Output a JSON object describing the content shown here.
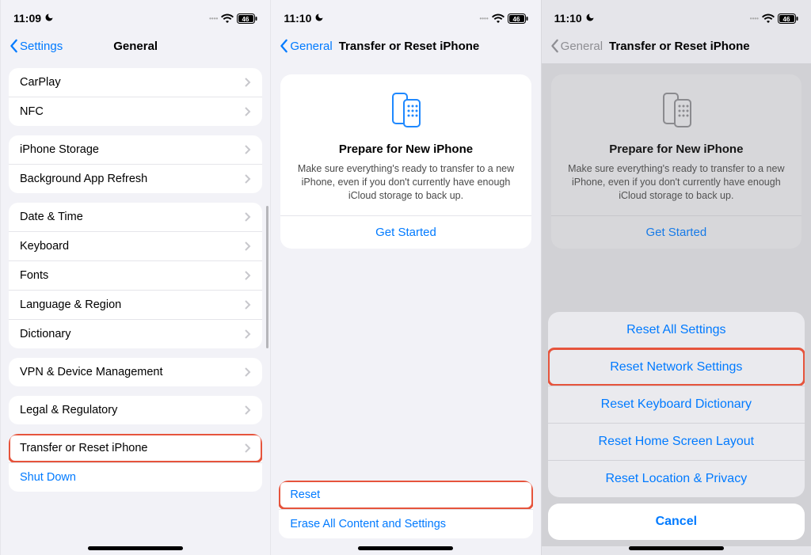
{
  "status": {
    "time1": "11:09",
    "time2": "11:10",
    "time3": "11:10",
    "battery": "46"
  },
  "screen1": {
    "back": "Settings",
    "title": "General",
    "g1": {
      "carplay": "CarPlay",
      "nfc": "NFC"
    },
    "g2": {
      "storage": "iPhone Storage",
      "refresh": "Background App Refresh"
    },
    "g3": {
      "datetime": "Date & Time",
      "keyboard": "Keyboard",
      "fonts": "Fonts",
      "langreg": "Language & Region",
      "dict": "Dictionary"
    },
    "g4": {
      "vpn": "VPN & Device Management"
    },
    "g5": {
      "legal": "Legal & Regulatory"
    },
    "g6": {
      "transfer": "Transfer or Reset iPhone",
      "shutdown": "Shut Down"
    }
  },
  "screen2": {
    "back": "General",
    "title": "Transfer or Reset iPhone",
    "card": {
      "title": "Prepare for New iPhone",
      "desc": "Make sure everything's ready to transfer to a new iPhone, even if you don't currently have enough iCloud storage to back up.",
      "action": "Get Started"
    },
    "reset": "Reset",
    "erase": "Erase All Content and Settings"
  },
  "screen3": {
    "back": "General",
    "title": "Transfer or Reset iPhone",
    "card": {
      "title": "Prepare for New iPhone",
      "desc": "Make sure everything's ready to transfer to a new iPhone, even if you don't currently have enough iCloud storage to back up.",
      "action": "Get Started"
    },
    "sheet": {
      "r1": "Reset All Settings",
      "r2": "Reset Network Settings",
      "r3": "Reset Keyboard Dictionary",
      "r4": "Reset Home Screen Layout",
      "r5": "Reset Location & Privacy"
    },
    "cancel": "Cancel"
  }
}
